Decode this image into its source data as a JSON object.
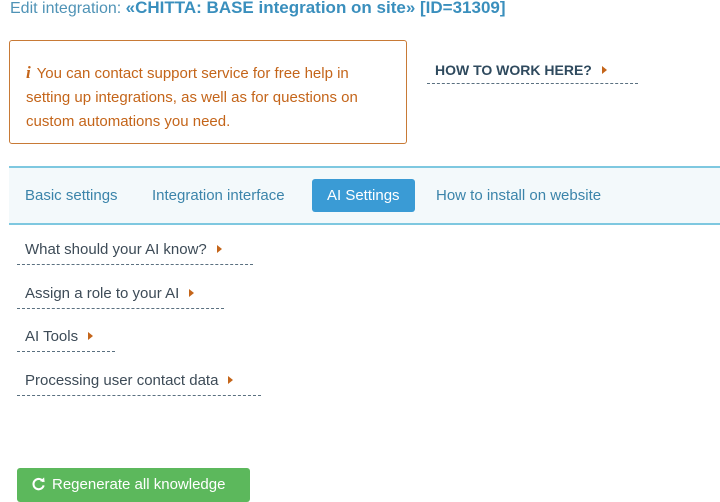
{
  "header": {
    "prefix": "Edit integration:",
    "name": "«CHITTA: BASE integration on site» [ID=31309]"
  },
  "notice": {
    "icon": "info-icon",
    "text": "You can contact support service for free help in setting up integrations, as well as for questions on custom automations you need."
  },
  "howto": {
    "label": "HOW TO WORK HERE?"
  },
  "tabs": [
    {
      "label": "Basic settings",
      "active": false
    },
    {
      "label": "Integration interface",
      "active": false
    },
    {
      "label": "AI Settings",
      "active": true
    },
    {
      "label": "How to install on website",
      "active": false
    }
  ],
  "sections": [
    {
      "label": "What should your AI know?"
    },
    {
      "label": "Assign a role to your AI"
    },
    {
      "label": "AI Tools"
    },
    {
      "label": "Processing user contact data"
    }
  ],
  "actions": {
    "regenerate": "Regenerate all knowledge"
  },
  "colors": {
    "accent": "#3a9bd5",
    "notice": "#c4651a",
    "success": "#5cb85c"
  }
}
